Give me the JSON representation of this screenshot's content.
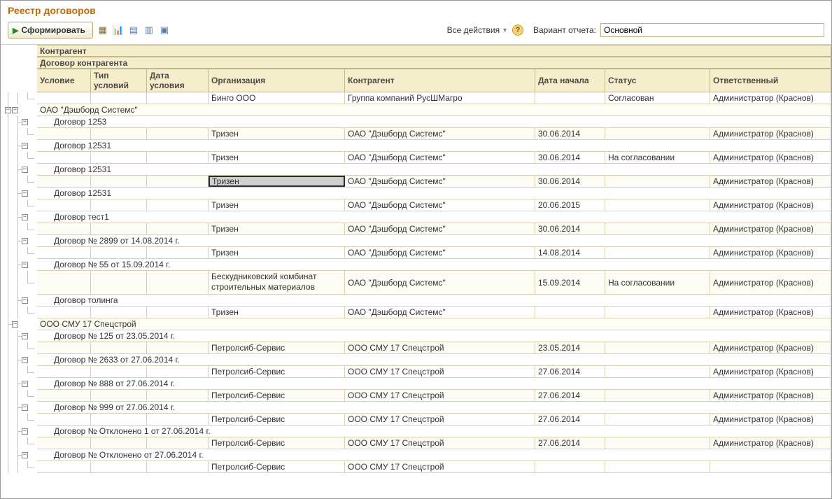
{
  "title": "Реестр договоров",
  "toolbar": {
    "generate": "Сформировать",
    "all_actions": "Все действия",
    "variant_label": "Вариант отчета:",
    "variant_value": "Основной"
  },
  "headers": {
    "level1": "Контрагент",
    "level2": "Договор контрагента",
    "c1": "Условие",
    "c2": "Тип условий",
    "c3": "Дата условия",
    "c4": "Организация",
    "c5": "Контрагент",
    "c6": "Дата начала",
    "c7": "Статус",
    "c8": "Ответственный"
  },
  "rows": [
    {
      "type": "data",
      "c4": "Бинго ООО",
      "c5": "Группа компаний РусШМагро",
      "c6": "",
      "c7": "Согласован",
      "c8": "Администратор (Краснов)"
    },
    {
      "type": "group",
      "label": "ОАО \"Дэшборд Системс\""
    },
    {
      "type": "contract",
      "label": "Договор  1253"
    },
    {
      "type": "data",
      "c4": "Тризен",
      "c5": "ОАО \"Дэшборд Системс\"",
      "c6": "30.06.2014",
      "c7": "",
      "c8": "Администратор (Краснов)"
    },
    {
      "type": "contract",
      "label": "Договор  12531"
    },
    {
      "type": "data",
      "c4": "Тризен",
      "c5": "ОАО \"Дэшборд Системс\"",
      "c6": "30.06.2014",
      "c7": "На согласовании",
      "c8": "Администратор (Краснов)"
    },
    {
      "type": "contract",
      "label": "Договор  12531"
    },
    {
      "type": "data",
      "c4": "Тризен",
      "c5": "ОАО \"Дэшборд Системс\"",
      "c6": "30.06.2014",
      "c7": "",
      "c8": "Администратор (Краснов)",
      "selected": true
    },
    {
      "type": "contract",
      "label": "Договор  12531"
    },
    {
      "type": "data",
      "c4": "Тризен",
      "c5": "ОАО \"Дэшборд Системс\"",
      "c6": "20.06.2015",
      "c7": "",
      "c8": "Администратор (Краснов)"
    },
    {
      "type": "contract",
      "label": "Договор  тест1"
    },
    {
      "type": "data",
      "c4": "Тризен",
      "c5": "ОАО \"Дэшборд Системс\"",
      "c6": "30.06.2014",
      "c7": "",
      "c8": "Администратор (Краснов)"
    },
    {
      "type": "contract",
      "label": "Договор № 2899 от 14.08.2014 г."
    },
    {
      "type": "data",
      "c4": "Тризен",
      "c5": "ОАО \"Дэшборд Системс\"",
      "c6": "14.08.2014",
      "c7": "",
      "c8": "Администратор (Краснов)"
    },
    {
      "type": "contract",
      "label": "Договор № 55 от 15.09.2014 г."
    },
    {
      "type": "data",
      "h34": true,
      "c4": "Бескудниковский комбинат строительных материалов",
      "c5": "ОАО \"Дэшборд Системс\"",
      "c6": "15.09.2014",
      "c7": "На согласовании",
      "c8": "Администратор (Краснов)"
    },
    {
      "type": "contract",
      "label": "Договор толинга"
    },
    {
      "type": "data",
      "c4": "Тризен",
      "c5": "ОАО \"Дэшборд Системс\"",
      "c6": "",
      "c7": "",
      "c8": "Администратор (Краснов)"
    },
    {
      "type": "group",
      "label": "ООО СМУ 17 Спецстрой"
    },
    {
      "type": "contract",
      "label": "Договор № 125 от 23.05.2014 г."
    },
    {
      "type": "data",
      "c4": "Петролсиб-Сервис",
      "c5": "ООО СМУ 17 Спецстрой",
      "c6": "23.05.2014",
      "c7": "",
      "c8": "Администратор (Краснов)"
    },
    {
      "type": "contract",
      "label": "Договор № 2633 от 27.06.2014 г."
    },
    {
      "type": "data",
      "c4": "Петролсиб-Сервис",
      "c5": "ООО СМУ 17 Спецстрой",
      "c6": "27.06.2014",
      "c7": "",
      "c8": "Администратор (Краснов)"
    },
    {
      "type": "contract",
      "label": "Договор № 888 от 27.06.2014 г."
    },
    {
      "type": "data",
      "c4": "Петролсиб-Сервис",
      "c5": "ООО СМУ 17 Спецстрой",
      "c6": "27.06.2014",
      "c7": "",
      "c8": "Администратор (Краснов)"
    },
    {
      "type": "contract",
      "label": "Договор № 999 от 27.06.2014 г."
    },
    {
      "type": "data",
      "c4": "Петролсиб-Сервис",
      "c5": "ООО СМУ 17 Спецстрой",
      "c6": "27.06.2014",
      "c7": "",
      "c8": "Администратор (Краснов)"
    },
    {
      "type": "contract",
      "label": "Договор № Отклонено 1 от 27.06.2014 г."
    },
    {
      "type": "data",
      "c4": "Петролсиб-Сервис",
      "c5": "ООО СМУ 17 Спецстрой",
      "c6": "27.06.2014",
      "c7": "",
      "c8": "Администратор (Краснов)"
    },
    {
      "type": "contract",
      "label": "Договор № Отклонено от 27.06.2014 г."
    },
    {
      "type": "data",
      "c4": "Петролсиб-Сервис",
      "c5": "ООО СМУ 17 Спецстрой",
      "c6": "",
      "c7": "",
      "c8": ""
    }
  ]
}
